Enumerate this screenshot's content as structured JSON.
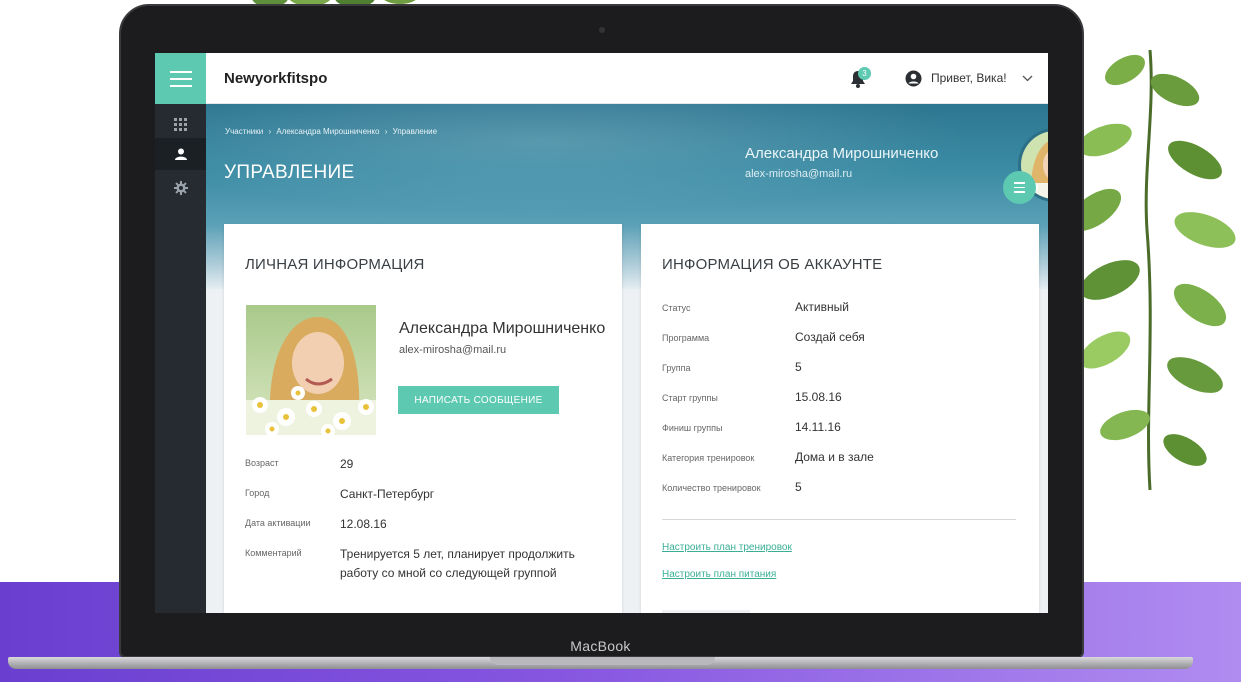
{
  "device": {
    "bezel_label": "MacBook"
  },
  "app": {
    "brand": "Newyorkfitspo",
    "notification_count": "3",
    "greeting": "Привет, Вика!"
  },
  "sidebar": {
    "items": [
      {
        "icon": "grid-icon",
        "active": false
      },
      {
        "icon": "user-icon",
        "active": true
      },
      {
        "icon": "gear-icon",
        "active": false
      }
    ]
  },
  "breadcrumb": [
    "Участники",
    "›",
    "Александра Мирошниченко",
    "›",
    "Управление"
  ],
  "page_title": "УПРАВЛЕНИЕ",
  "profile_header": {
    "name": "Александра Мирошниченко",
    "email": "alex-mirosha@mail.ru"
  },
  "personal": {
    "title": "ЛИЧНАЯ ИНФОРМАЦИЯ",
    "name": "Александра Мирошниченко",
    "email": "alex-mirosha@mail.ru",
    "message_button": "НАПИСАТЬ СООБЩЕНИЕ",
    "fields": [
      {
        "label": "Возраст",
        "value": "29"
      },
      {
        "label": "Город",
        "value": "Санкт-Петербург"
      },
      {
        "label": "Дата активации",
        "value": "12.08.16"
      },
      {
        "label": "Комментарий",
        "value": "Тренируется 5 лет, планирует продолжить работу со мной со следующей группой"
      }
    ]
  },
  "account": {
    "title": "ИНФОРМАЦИЯ ОБ АККАУНТЕ",
    "fields": [
      {
        "label": "Статус",
        "value": "Активный"
      },
      {
        "label": "Программа",
        "value": "Создай себя"
      },
      {
        "label": "Группа",
        "value": "5"
      },
      {
        "label": "Старт группы",
        "value": "15.08.16"
      },
      {
        "label": "Финиш группы",
        "value": "14.11.16"
      },
      {
        "label": "Категория тренировок",
        "value": "Дома и в зале"
      },
      {
        "label": "Количество тренировок",
        "value": "5"
      }
    ],
    "links": [
      "Настроить план тренировок",
      "Настроить план питания"
    ]
  },
  "colors": {
    "accent": "#5cc9b0",
    "sidebar": "#252b31",
    "hero": "#2d7691",
    "floor": "#7a4ad8"
  }
}
